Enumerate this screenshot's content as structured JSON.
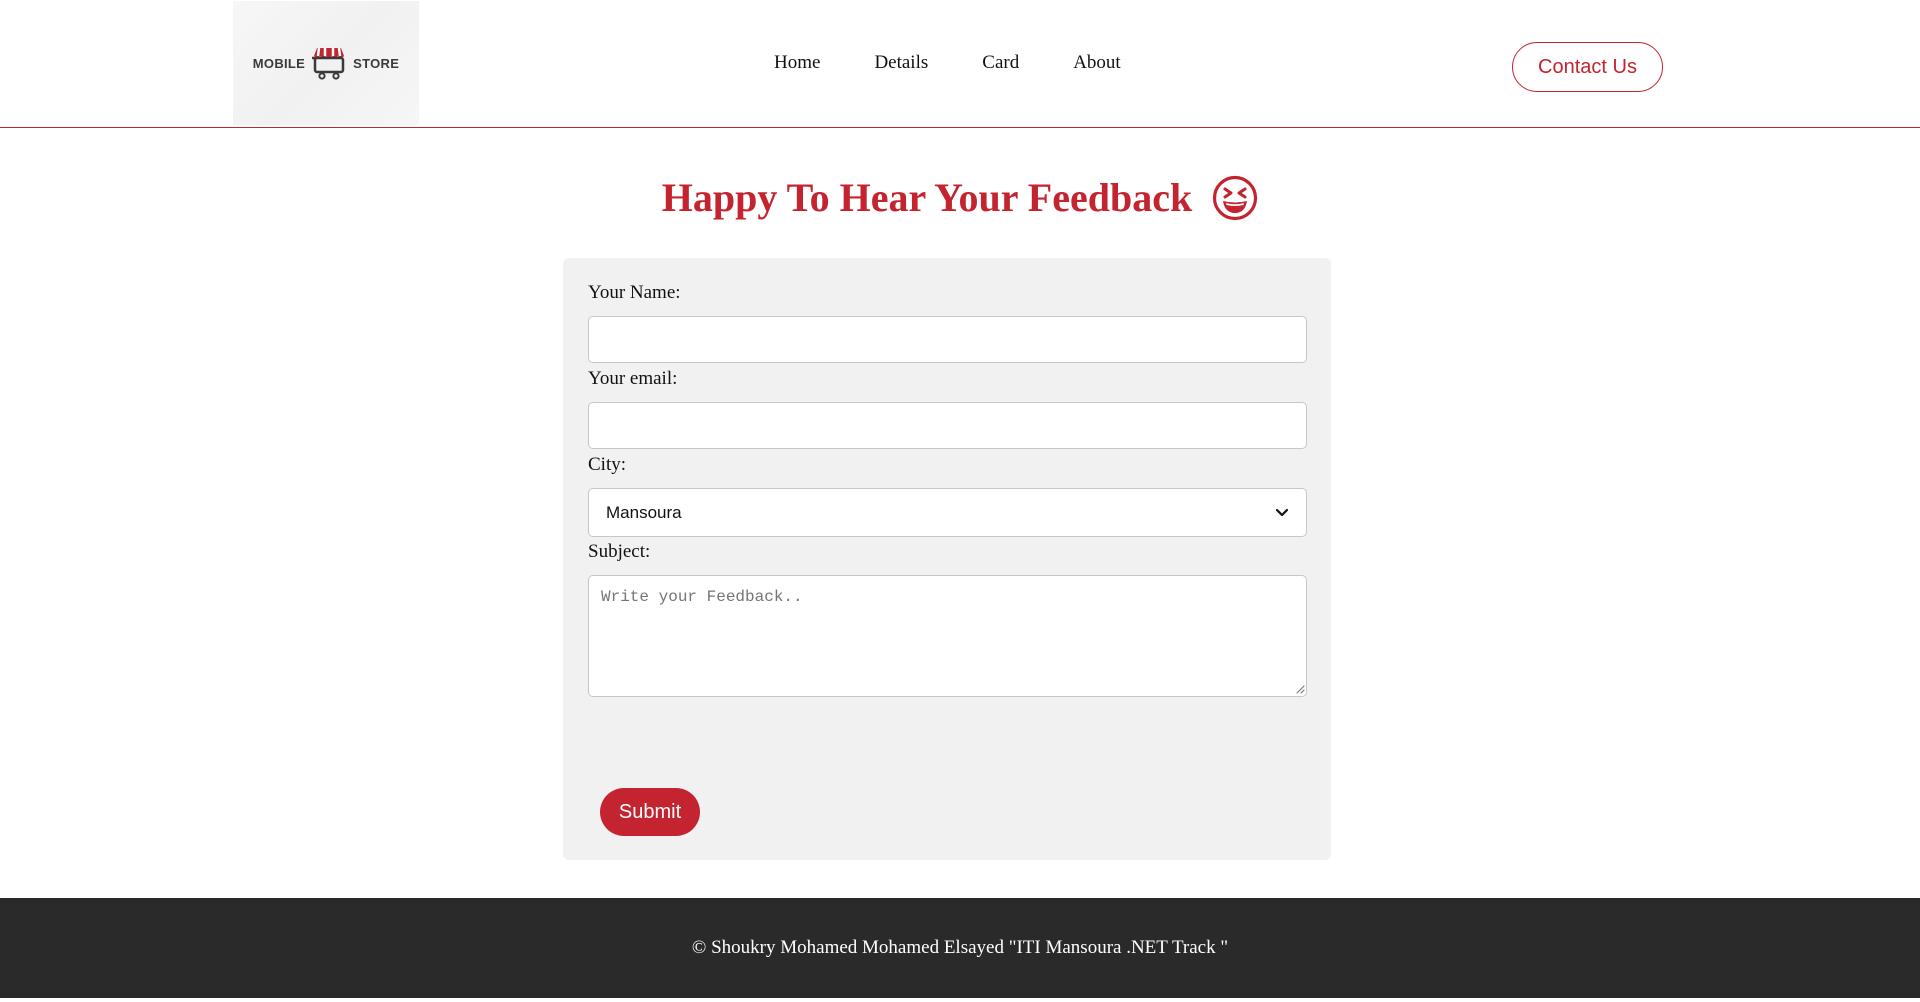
{
  "brand": {
    "logo_left": "MOBILE",
    "logo_right": "STORE",
    "accent_color": "#c4242f"
  },
  "nav": {
    "items": [
      "Home",
      "Details",
      "Card",
      "About"
    ],
    "contact_label": "Contact Us"
  },
  "main": {
    "title": "Happy To Hear Your Feedback",
    "title_icon": "grinning-squinting-face-emoji"
  },
  "form": {
    "name_label": "Your Name:",
    "name_value": "",
    "email_label": "Your email:",
    "email_value": "",
    "city_label": "City:",
    "city_selected": "Mansoura",
    "subject_label": "Subject:",
    "subject_placeholder": "Write your Feedback..",
    "submit_label": "Submit"
  },
  "footer": {
    "text": "© Shoukry Mohamed Mohamed Elsayed \"ITI Mansoura .NET Track \""
  }
}
